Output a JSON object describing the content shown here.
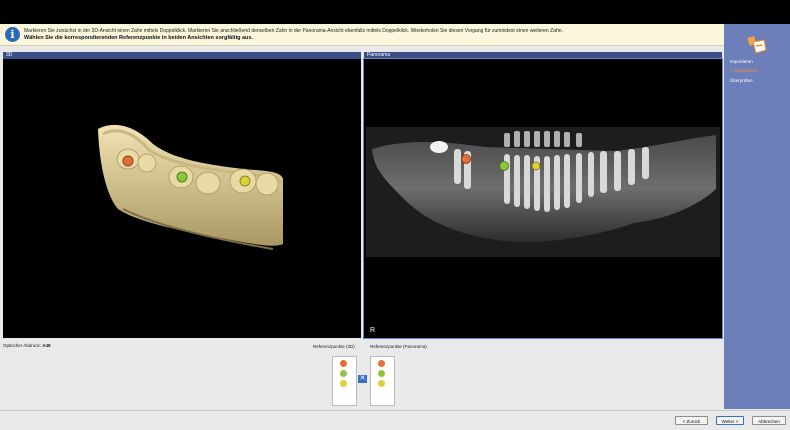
{
  "info": {
    "line1": "Markieren Sie zunächst in der 3D-Ansicht einen Zahn mittels Doppelklick. Markieren Sie anschließend denselben Zahn in der Panorama-Ansicht ebenfalls mittels Doppelklick. Wiederholen Sie diesen Vorgang für zumindest einen weiteren Zahn.",
    "line2": "Wählen Sie die korrespondierenden Referenzpunkte in beiden Ansichten sorgfältig aus."
  },
  "views": {
    "left_title": "3D",
    "right_title": "Panorama",
    "r_marker": "R"
  },
  "optical": {
    "label": "Optischer Abdruck:",
    "value": "A48"
  },
  "refs": {
    "label_3d": "Referenzpunkte (3D)",
    "label_pano": "Referenzpunkte (Panorama)",
    "colors": [
      "#e0703a",
      "#8cc63f",
      "#d9d23a"
    ]
  },
  "sidebar": {
    "items": [
      {
        "label": "Importieren",
        "active": false
      },
      {
        "label": "»  Registrieren",
        "active": true
      },
      {
        "label": "Überprüfen",
        "active": false
      }
    ]
  },
  "buttons": {
    "back": "< Zurück",
    "next": "Weiter >",
    "cancel": "Abbrechen"
  }
}
